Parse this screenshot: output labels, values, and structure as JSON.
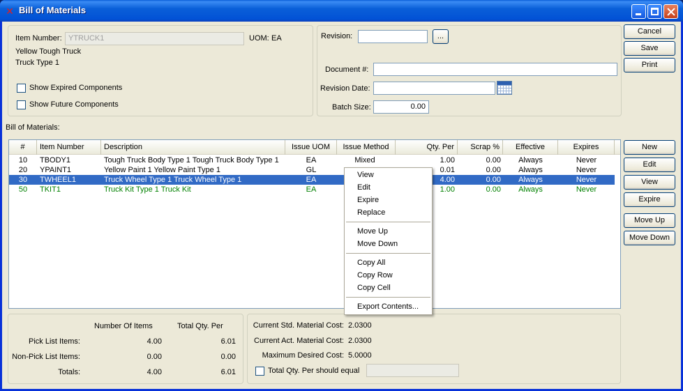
{
  "window": {
    "title": "Bill of Materials"
  },
  "header": {
    "item_number_label": "Item Number:",
    "item_number_value": "YTRUCK1",
    "uom_label": "UOM:",
    "uom_value": "EA",
    "desc1": "Yellow Tough Truck",
    "desc2": "Truck Type 1",
    "show_expired_label": "Show Expired Components",
    "show_future_label": "Show Future Components"
  },
  "revision": {
    "revision_label": "Revision:",
    "revision_value": "",
    "browse_label": "...",
    "document_label": "Document #:",
    "document_value": "",
    "revision_date_label": "Revision Date:",
    "revision_date_value": "",
    "batch_size_label": "Batch Size:",
    "batch_size_value": "0.00"
  },
  "actions": {
    "cancel": "Cancel",
    "save": "Save",
    "print": "Print"
  },
  "bom": {
    "section_label": "Bill of Materials:",
    "columns": [
      "#",
      "Item Number",
      "Description",
      "Issue UOM",
      "Issue Method",
      "Qty. Per",
      "Scrap %",
      "Effective",
      "Expires"
    ],
    "rows": [
      {
        "seq": "10",
        "item": "TBODY1",
        "desc": "Tough Truck Body Type 1 Tough Truck Body Type 1",
        "uom": "EA",
        "method": "Mixed",
        "qty": "1.00",
        "scrap": "0.00",
        "effective": "Always",
        "expires": "Never",
        "style": "normal"
      },
      {
        "seq": "20",
        "item": "YPAINT1",
        "desc": "Yellow Paint 1  Yellow Paint Type 1",
        "uom": "GL",
        "method": "",
        "qty": "0.01",
        "scrap": "0.00",
        "effective": "Always",
        "expires": "Never",
        "style": "normal"
      },
      {
        "seq": "30",
        "item": "TWHEEL1",
        "desc": "Truck Wheel Type 1 Truck Wheel Type 1",
        "uom": "EA",
        "method": "",
        "qty": "4.00",
        "scrap": "0.00",
        "effective": "Always",
        "expires": "Never",
        "style": "selected"
      },
      {
        "seq": "50",
        "item": "TKIT1",
        "desc": "Truck Kit Type 1 Truck Kit",
        "uom": "EA",
        "method": "",
        "qty": "1.00",
        "scrap": "0.00",
        "effective": "Always",
        "expires": "Never",
        "style": "green"
      }
    ]
  },
  "side_buttons": {
    "new": "New",
    "edit": "Edit",
    "view": "View",
    "expire": "Expire",
    "move_up": "Move Up",
    "move_down": "Move Down"
  },
  "context_menu": {
    "items": [
      "View",
      "Edit",
      "Expire",
      "Replace",
      "Move Up",
      "Move Down",
      "Copy All",
      "Copy Row",
      "Copy Cell",
      "Export Contents..."
    ]
  },
  "totals": {
    "col_items": "Number Of Items",
    "col_qty": "Total Qty. Per",
    "pick_label": "Pick List Items:",
    "pick_items": "4.00",
    "pick_qty": "6.01",
    "nonpick_label": "Non-Pick List Items:",
    "nonpick_items": "0.00",
    "nonpick_qty": "0.00",
    "totals_label": "Totals:",
    "totals_items": "4.00",
    "totals_qty": "6.01"
  },
  "costs": {
    "std_label": "Current Std. Material Cost:",
    "std_value": "2.0300",
    "act_label": "Current Act. Material Cost:",
    "act_value": "2.0300",
    "desired_label": "Maximum Desired Cost:",
    "desired_value": "5.0000",
    "total_qty_label": "Total Qty. Per should equal",
    "total_qty_value": ""
  }
}
